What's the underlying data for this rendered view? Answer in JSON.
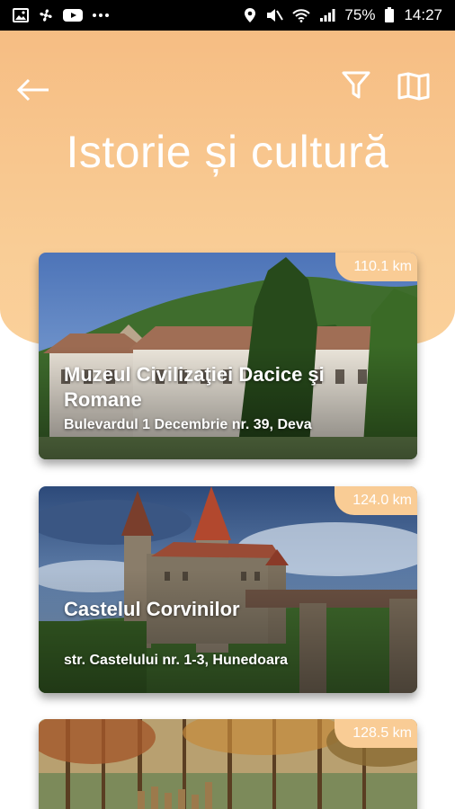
{
  "status_bar": {
    "battery": "75%",
    "time": "14:27",
    "left_icons": [
      "image-icon",
      "fan-icon",
      "youtube-icon",
      "more-dots-icon"
    ],
    "right_icons": [
      "location-icon",
      "mute-icon",
      "wifi-icon",
      "signal-icon",
      "battery-icon"
    ]
  },
  "header": {
    "title": "Istorie și cultură",
    "background_color": "#f8c790",
    "icons": [
      "back-arrow-icon",
      "filter-icon",
      "map-icon"
    ]
  },
  "cards": [
    {
      "distance": "110.1 km",
      "title": "Muzeul Civilizaţiei Dacice şi Romane",
      "address": "Bulevardul 1 Decembrie nr. 39, Deva"
    },
    {
      "distance": "124.0 km",
      "title": "Castelul Corvinilor",
      "address": "str. Castelului nr. 1-3, Hunedoara"
    },
    {
      "distance": "128.5 km",
      "title": "",
      "address": ""
    }
  ]
}
